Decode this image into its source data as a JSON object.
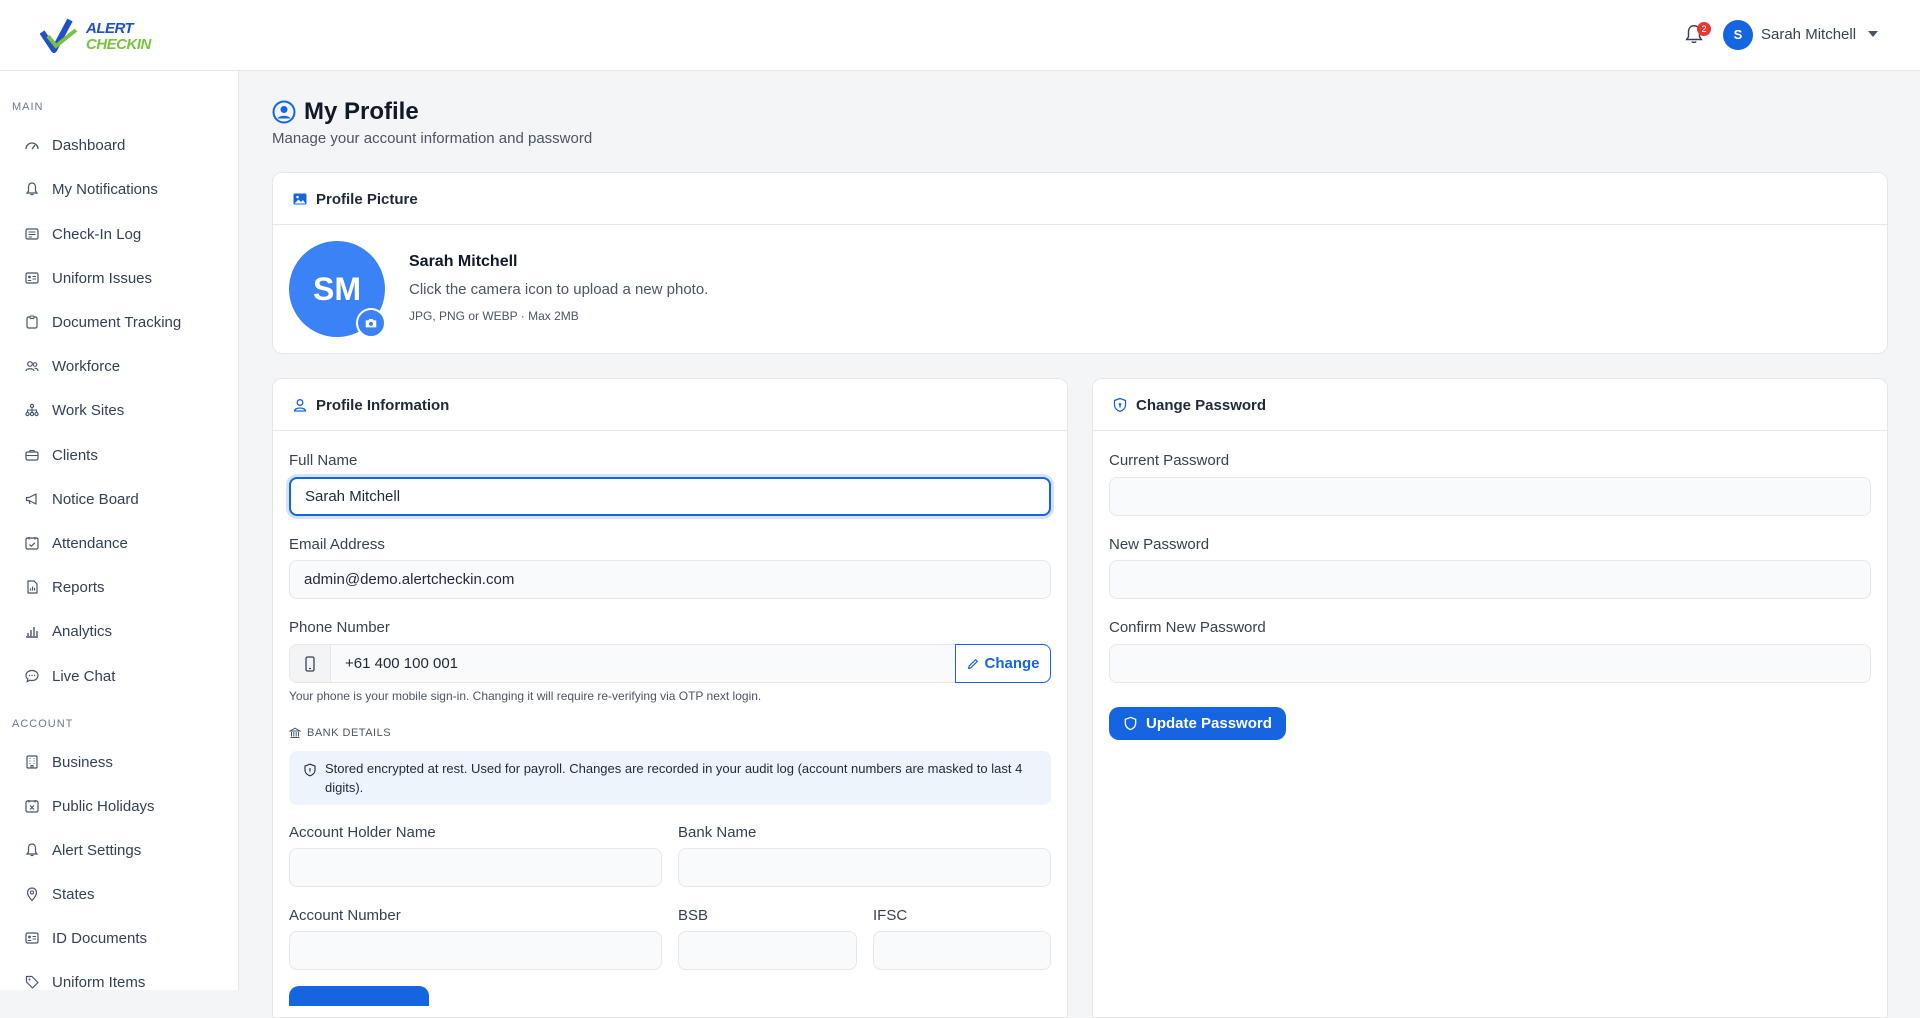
{
  "brand": {
    "line1": "ALERT",
    "line2": "CHECKIN"
  },
  "topbar": {
    "notification_count": "2",
    "user_initial": "S",
    "user_name": "Sarah Mitchell"
  },
  "sidebar": {
    "main_label": "MAIN",
    "main_items": [
      {
        "label": "Dashboard",
        "icon": "dashboard-icon"
      },
      {
        "label": "My Notifications",
        "icon": "bell-icon"
      },
      {
        "label": "Check-In Log",
        "icon": "list-icon"
      },
      {
        "label": "Uniform Issues",
        "icon": "id-card-icon"
      },
      {
        "label": "Document Tracking",
        "icon": "clipboard-icon"
      },
      {
        "label": "Workforce",
        "icon": "people-icon"
      },
      {
        "label": "Work Sites",
        "icon": "sitemap-icon"
      },
      {
        "label": "Clients",
        "icon": "briefcase-icon"
      },
      {
        "label": "Notice Board",
        "icon": "megaphone-icon"
      },
      {
        "label": "Attendance",
        "icon": "calendar-check-icon"
      },
      {
        "label": "Reports",
        "icon": "report-icon"
      },
      {
        "label": "Analytics",
        "icon": "bar-chart-icon"
      },
      {
        "label": "Live Chat",
        "icon": "chat-icon"
      }
    ],
    "account_label": "ACCOUNT",
    "account_items": [
      {
        "label": "Business",
        "icon": "building-icon"
      },
      {
        "label": "Public Holidays",
        "icon": "calendar-x-icon"
      },
      {
        "label": "Alert Settings",
        "icon": "bell-icon"
      },
      {
        "label": "States",
        "icon": "map-pin-icon"
      },
      {
        "label": "ID Documents",
        "icon": "id-card-icon"
      },
      {
        "label": "Uniform Items",
        "icon": "tag-icon"
      }
    ]
  },
  "page": {
    "title": "My Profile",
    "subtitle": "Manage your account information and password"
  },
  "profile_picture": {
    "header": "Profile Picture",
    "initials": "SM",
    "name": "Sarah Mitchell",
    "help": "Click the camera icon to upload a new photo.",
    "note": "JPG, PNG or WEBP · Max 2MB"
  },
  "profile_info": {
    "header": "Profile Information",
    "full_name_label": "Full Name",
    "full_name_value": "Sarah Mitchell",
    "email_label": "Email Address",
    "email_value": "admin@demo.alertcheckin.com",
    "phone_label": "Phone Number",
    "phone_value": "+61 400 100 001",
    "change_label": "Change",
    "phone_helper": "Your phone is your mobile sign-in. Changing it will require re-verifying via OTP next login.",
    "bank_heading": "BANK DETAILS",
    "bank_info": "Stored encrypted at rest. Used for payroll. Changes are recorded in your audit log (account numbers are masked to last 4 digits).",
    "account_holder_label": "Account Holder Name",
    "bank_name_label": "Bank Name",
    "account_number_label": "Account Number",
    "bsb_label": "BSB",
    "ifsc_label": "IFSC"
  },
  "change_password": {
    "header": "Change Password",
    "current_label": "Current Password",
    "new_label": "New Password",
    "confirm_label": "Confirm New Password",
    "button_label": "Update Password"
  },
  "colors": {
    "primary": "#1565e0",
    "avatar": "#3b82f6",
    "badge": "#e53935",
    "brand_blue": "#1e50c8",
    "brand_green": "#7ac143"
  }
}
